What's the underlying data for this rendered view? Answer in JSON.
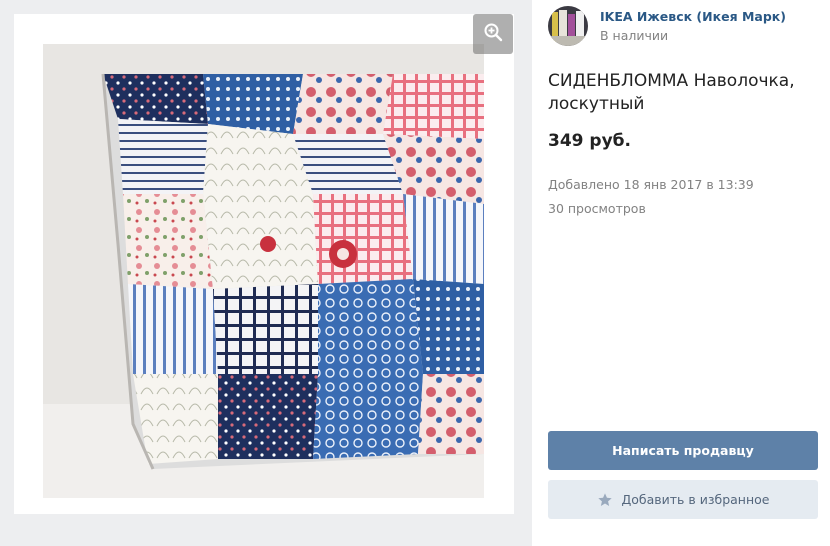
{
  "colors": {
    "link": "#2a5885",
    "muted": "#828282",
    "primary_button": "#5e81a8",
    "secondary_button": "#e5ebf1",
    "backdrop": "#edeef0"
  },
  "gallery": {
    "zoom_icon": "zoom-in-icon",
    "photo_subject": "patchwork pillowcase"
  },
  "shop": {
    "name": "IKEA Ижевск (Икея Марк)",
    "status": "В наличии"
  },
  "product": {
    "title": "СИДЕНБЛОММА Наволочка, лоскутный",
    "price": "349 руб.",
    "date_added": "Добавлено 18 янв 2017 в 13:39",
    "views": "30 просмотров"
  },
  "actions": {
    "contact_seller": "Написать продавцу",
    "add_favorite": "Добавить в избранное",
    "favorite_icon": "star-icon"
  }
}
